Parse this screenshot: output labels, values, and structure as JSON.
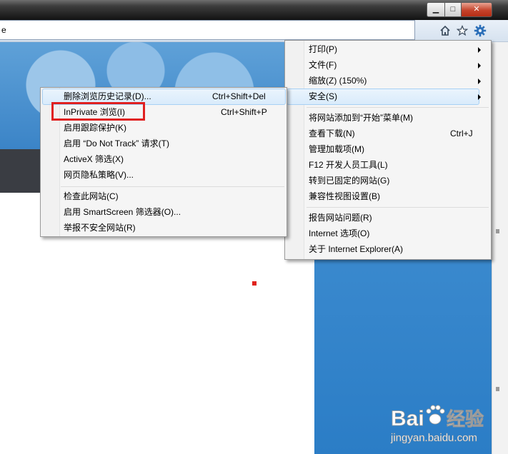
{
  "toolbar": {
    "address_text": "e"
  },
  "icons": {
    "home": "home-icon",
    "favorites": "star-icon",
    "tools": "gear-icon"
  },
  "tools_menu": {
    "items": [
      {
        "label": "打印(P)",
        "shortcut": "",
        "submenu": true
      },
      {
        "label": "文件(F)",
        "shortcut": "",
        "submenu": true
      },
      {
        "label": "缩放(Z) (150%)",
        "shortcut": "",
        "submenu": true
      },
      {
        "label": "安全(S)",
        "shortcut": "",
        "submenu": true,
        "highlighted": true
      },
      {
        "label": "将网站添加到“开始”菜单(M)",
        "shortcut": ""
      },
      {
        "label": "查看下载(N)",
        "shortcut": "Ctrl+J"
      },
      {
        "label": "管理加载项(M)",
        "shortcut": ""
      },
      {
        "label": "F12 开发人员工具(L)",
        "shortcut": ""
      },
      {
        "label": "转到已固定的网站(G)",
        "shortcut": ""
      },
      {
        "label": "兼容性视图设置(B)",
        "shortcut": ""
      },
      {
        "label": "报告网站问题(R)",
        "shortcut": ""
      },
      {
        "label": "Internet 选项(O)",
        "shortcut": ""
      },
      {
        "label": "关于 Internet Explorer(A)",
        "shortcut": ""
      }
    ]
  },
  "safety_menu": {
    "items": [
      {
        "label": "删除浏览历史记录(D)...",
        "shortcut": "Ctrl+Shift+Del",
        "highlighted": true
      },
      {
        "label": "InPrivate 浏览(I)",
        "shortcut": "Ctrl+Shift+P",
        "annotated": true
      },
      {
        "label": "启用跟踪保护(K)",
        "shortcut": ""
      },
      {
        "label": "启用 “Do Not Track” 请求(T)",
        "shortcut": ""
      },
      {
        "label": "ActiveX 筛选(X)",
        "shortcut": ""
      },
      {
        "label": "网页隐私策略(V)...",
        "shortcut": ""
      },
      {
        "label": "检查此网站(C)",
        "shortcut": ""
      },
      {
        "label": "启用 SmartScreen 筛选器(O)...",
        "shortcut": ""
      },
      {
        "label": "举报不安全网站(R)",
        "shortcut": ""
      }
    ]
  },
  "watermark": {
    "brand_left": "Bai",
    "brand_right": "经验",
    "url": "jingyan.baidu.com"
  },
  "colors": {
    "annotation_red": "#e02020",
    "menu_highlight": "#d9ebfb",
    "background_blue": "#3b84c7"
  }
}
